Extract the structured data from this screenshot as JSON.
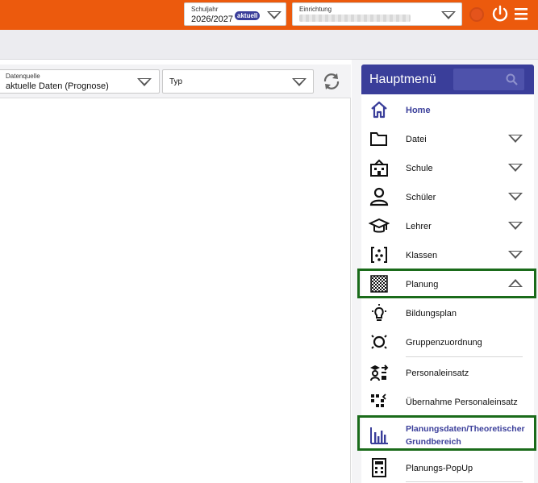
{
  "header": {
    "schuljahr_label": "Schuljahr",
    "schuljahr_value": "2026/2027",
    "schuljahr_badge": "aktuell",
    "einrichtung_label": "Einrichtung",
    "icons": [
      "record-icon",
      "power-icon",
      "hamburger-icon"
    ]
  },
  "filters": {
    "datenquelle_label": "Datenquelle",
    "datenquelle_value": "aktuelle Daten (Prognose)",
    "typ_value": "Typ"
  },
  "menu": {
    "title": "Hauptmenü",
    "items": [
      {
        "label": "Home",
        "icon": "home-icon",
        "active": true
      },
      {
        "label": "Datei",
        "icon": "folder-icon"
      },
      {
        "label": "Schule",
        "icon": "school-icon"
      },
      {
        "label": "Schüler",
        "icon": "person-icon"
      },
      {
        "label": "Lehrer",
        "icon": "graduation-cap-icon"
      },
      {
        "label": "Klassen",
        "icon": "class-icon"
      },
      {
        "label": "Planung",
        "icon": "checkerboard-icon",
        "expanded": true
      },
      {
        "label": "Bildungsplan",
        "icon": "lightbulb-icon"
      },
      {
        "label": "Gruppenzuordnung",
        "icon": "group-assign-icon"
      },
      {
        "label": "Personaleinsatz",
        "icon": "personnel-icon"
      },
      {
        "label": "Übernahme Personaleinsatz",
        "icon": "transfer-icon"
      },
      {
        "label": "Planungsdaten/Theoretischer Grundbereich",
        "label_line1": "Planungsdaten/Theoretischer",
        "label_line2": "Grundbereich",
        "icon": "bar-chart-icon",
        "selected": true
      },
      {
        "label": "Planungs-PopUp",
        "icon": "calculator-icon"
      }
    ]
  },
  "colors": {
    "topbar": "#ec5a0d",
    "menu_header": "#3a3e9a",
    "highlight": "#1a6b1a"
  }
}
